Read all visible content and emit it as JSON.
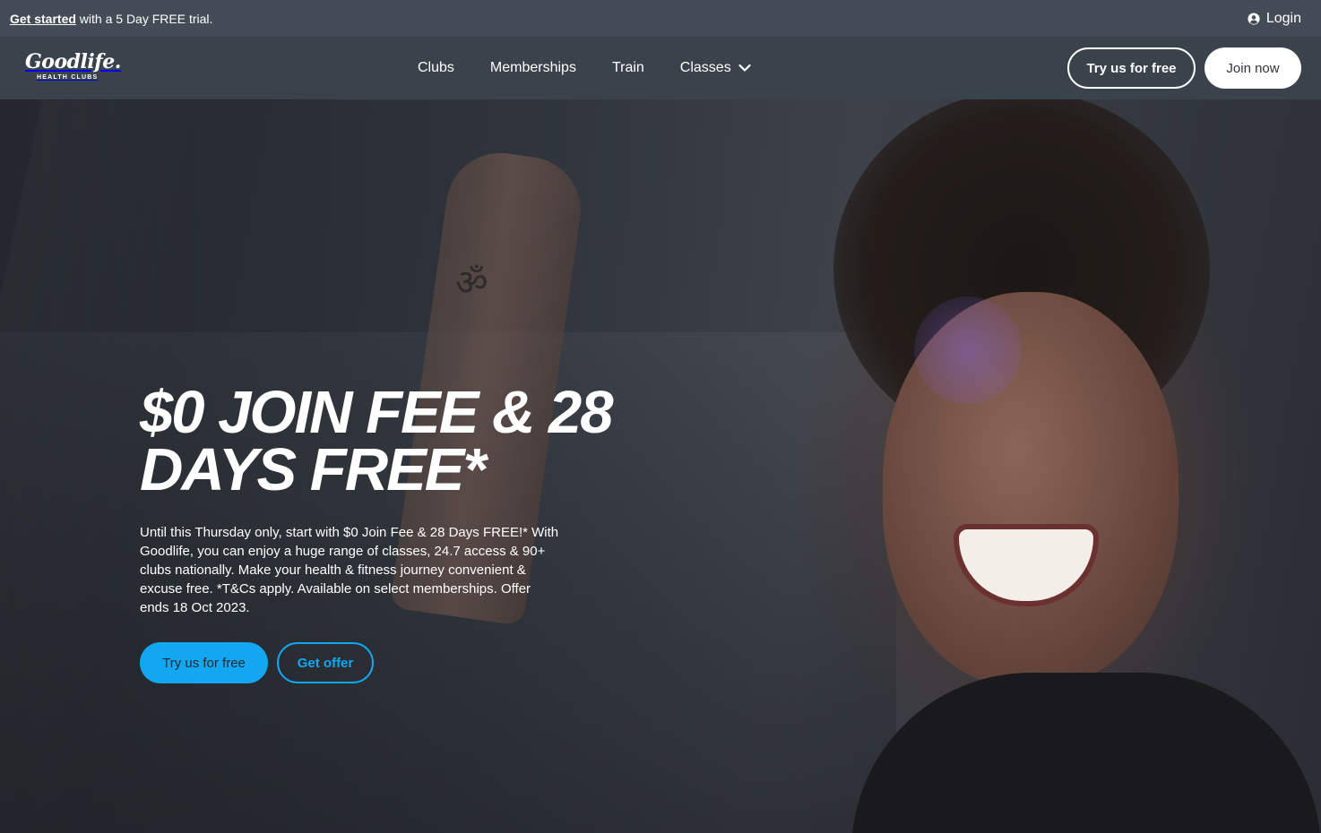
{
  "topbar": {
    "promo_link": "Get started",
    "promo_text": " with a 5 Day FREE trial.",
    "login_label": "Login",
    "login_icon": "user-circle-icon"
  },
  "nav": {
    "logo_text": "Goodlife.",
    "logo_subtext": "HEALTH CLUBS",
    "items": [
      {
        "label": "Clubs"
      },
      {
        "label": "Memberships"
      },
      {
        "label": "Train"
      },
      {
        "label": "Classes",
        "icon": "chevron-down-icon"
      }
    ],
    "try_free_label": "Try us for free",
    "join_label": "Join now"
  },
  "hero": {
    "headline_line1": "$0 JOIN FEE & 28",
    "headline_line2": "DAYS FREE*",
    "body": "Until this Thursday only, start with $0 Join Fee & 28 Days FREE!* With Goodlife, you can enjoy a huge range of classes, 24.7 access & 90+ clubs nationally. Make your health & fitness journey convenient & excuse free. *T&Cs apply. Available on select memberships. Offer ends 18 Oct 2023.",
    "primary_cta": "Try us for free",
    "secondary_cta": "Get offer"
  },
  "colors": {
    "accent_blue": "#12a7f0",
    "nav_bg": "#3a424b",
    "topbar_bg": "#434c57"
  }
}
